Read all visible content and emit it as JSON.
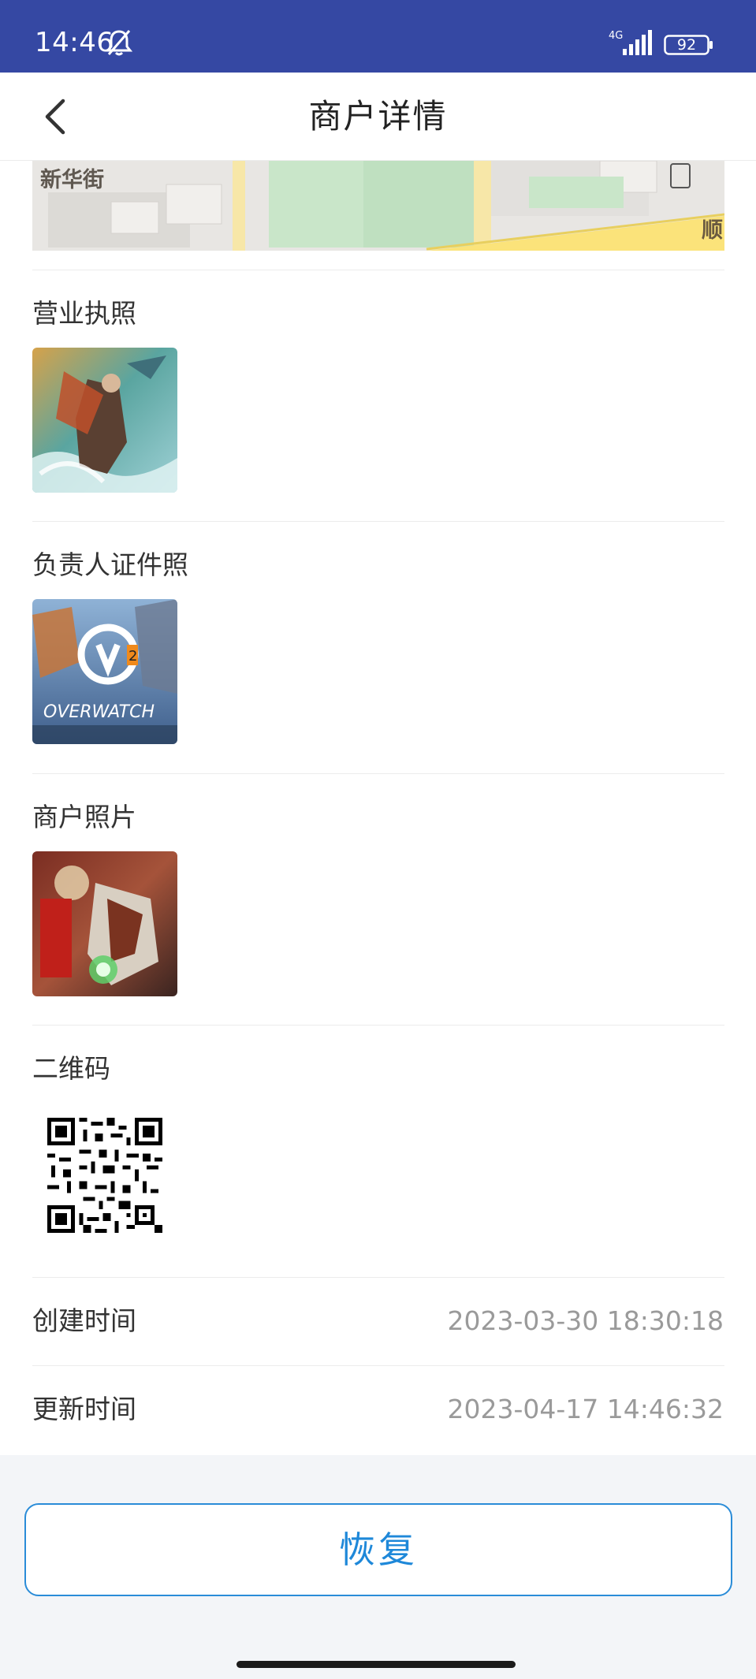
{
  "status_bar": {
    "time": "14:46",
    "network": "4G",
    "battery": "92",
    "bar_color": "#3548a3"
  },
  "nav": {
    "title": "商户详情",
    "back_icon": "chevron-left-icon"
  },
  "map": {
    "labels": [
      "新华街",
      "顺"
    ]
  },
  "sections": {
    "business_license": {
      "label": "营业执照"
    },
    "id_photo": {
      "label": "负责人证件照",
      "image_text": "OVERWATCH",
      "badge": "2"
    },
    "merchant_photo": {
      "label": "商户照片"
    },
    "qr_code": {
      "label": "二维码"
    }
  },
  "info_rows": [
    {
      "label": "创建时间",
      "value": "2023-03-30 18:30:18"
    },
    {
      "label": "更新时间",
      "value": "2023-04-17 14:46:32"
    }
  ],
  "actions": {
    "restore_label": "恢复",
    "accent_color": "#1e88d9"
  }
}
